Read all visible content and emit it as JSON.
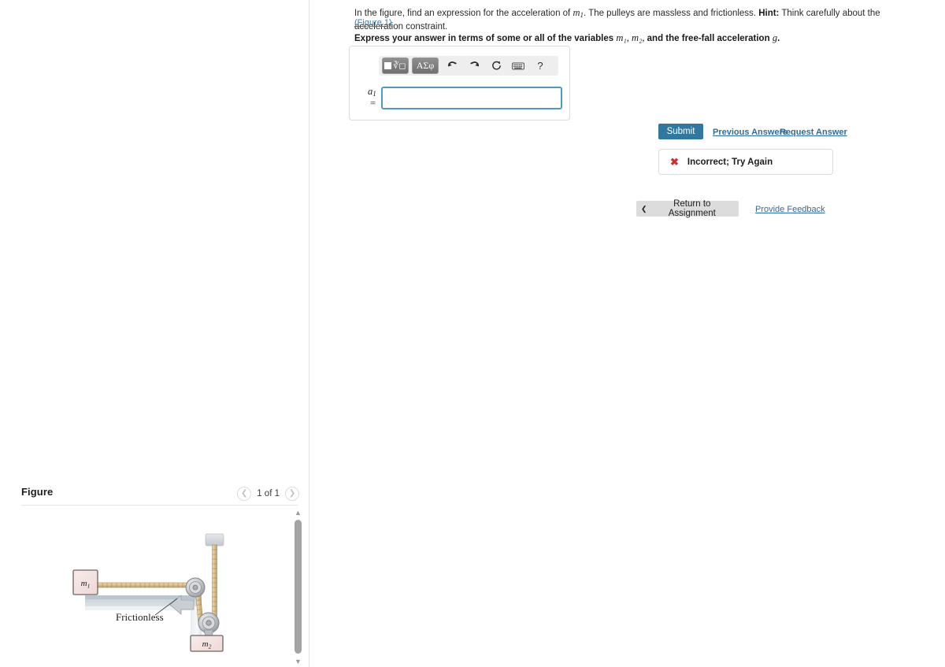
{
  "problem": {
    "statement_part1": "In the figure, find an expression for the acceleration of ",
    "statement_var": "m",
    "statement_sub": "1",
    "statement_part2": ". The pulleys are massless and frictionless. ",
    "hint_label": "Hint:",
    "hint_text": " Think carefully about the acceleration constraint.",
    "figure_link": "(Figure 1)",
    "express_prefix": "Express your answer in terms of some or all of the variables ",
    "express_vars": "m₁, m₂,",
    "express_middle": " and the free-fall acceleration ",
    "express_g": "g",
    "express_suffix": "."
  },
  "toolbar": {
    "template_button": "template-math",
    "greek_button": "ΑΣφ",
    "undo_icon": "undo-arrow-icon",
    "redo_icon": "redo-arrow-icon",
    "reset_icon": "reset-circular-arrow-icon",
    "keyboard_icon": "keyboard-icon",
    "help_label": "?"
  },
  "answer": {
    "label_var": "a",
    "label_sub": "1",
    "label_eq": "=",
    "value": "",
    "placeholder": ""
  },
  "actions": {
    "submit": "Submit",
    "previous_answers": "Previous Answers",
    "request_answer": "Request Answer",
    "return_to_assignment": "Return to Assignment",
    "provide_feedback": "Provide Feedback"
  },
  "feedback": {
    "icon": "red-x-icon",
    "message": "Incorrect; Try Again"
  },
  "figure_panel": {
    "title": "Figure",
    "prev_icon": "chevron-left-icon",
    "next_icon": "chevron-right-icon",
    "counter": "1 of 1",
    "scroll_up_icon": "triangle-up-icon",
    "scroll_down_icon": "triangle-down-icon"
  },
  "diagram": {
    "block1_label": "m₁",
    "block2_label": "m₂",
    "surface_label": "Frictionless",
    "colors": {
      "block_fill": "#f2dfdc",
      "block_stroke": "#7a6a68",
      "rope": "#d9b98a",
      "rope_stroke": "#a78350",
      "pulley": "#c9c9cd",
      "pulley_stroke": "#7f7f86",
      "table": "#d7dde0",
      "ceiling": "#d2d6da"
    }
  },
  "colors": {
    "submit_bg": "#31789e",
    "link": "#2c6e9a",
    "input_border": "#4e9bc0",
    "error": "#d32f2f",
    "panel_divider": "#dfe3e6"
  }
}
